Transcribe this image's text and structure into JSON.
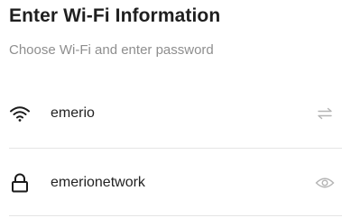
{
  "header": {
    "title": "Enter Wi-Fi Information",
    "subtitle": "Choose Wi-Fi and enter password"
  },
  "wifi_field": {
    "value": "emerio",
    "icon": "wifi-icon",
    "action_icon": "switch-network-icon"
  },
  "password_field": {
    "value": "emerionetwork",
    "icon": "lock-icon",
    "action_icon": "eye-icon"
  },
  "colors": {
    "title": "#1f1f1f",
    "subtitle": "#8e8e8e",
    "divider": "#e4e4e4",
    "muted_icon": "#b5b5b5"
  }
}
